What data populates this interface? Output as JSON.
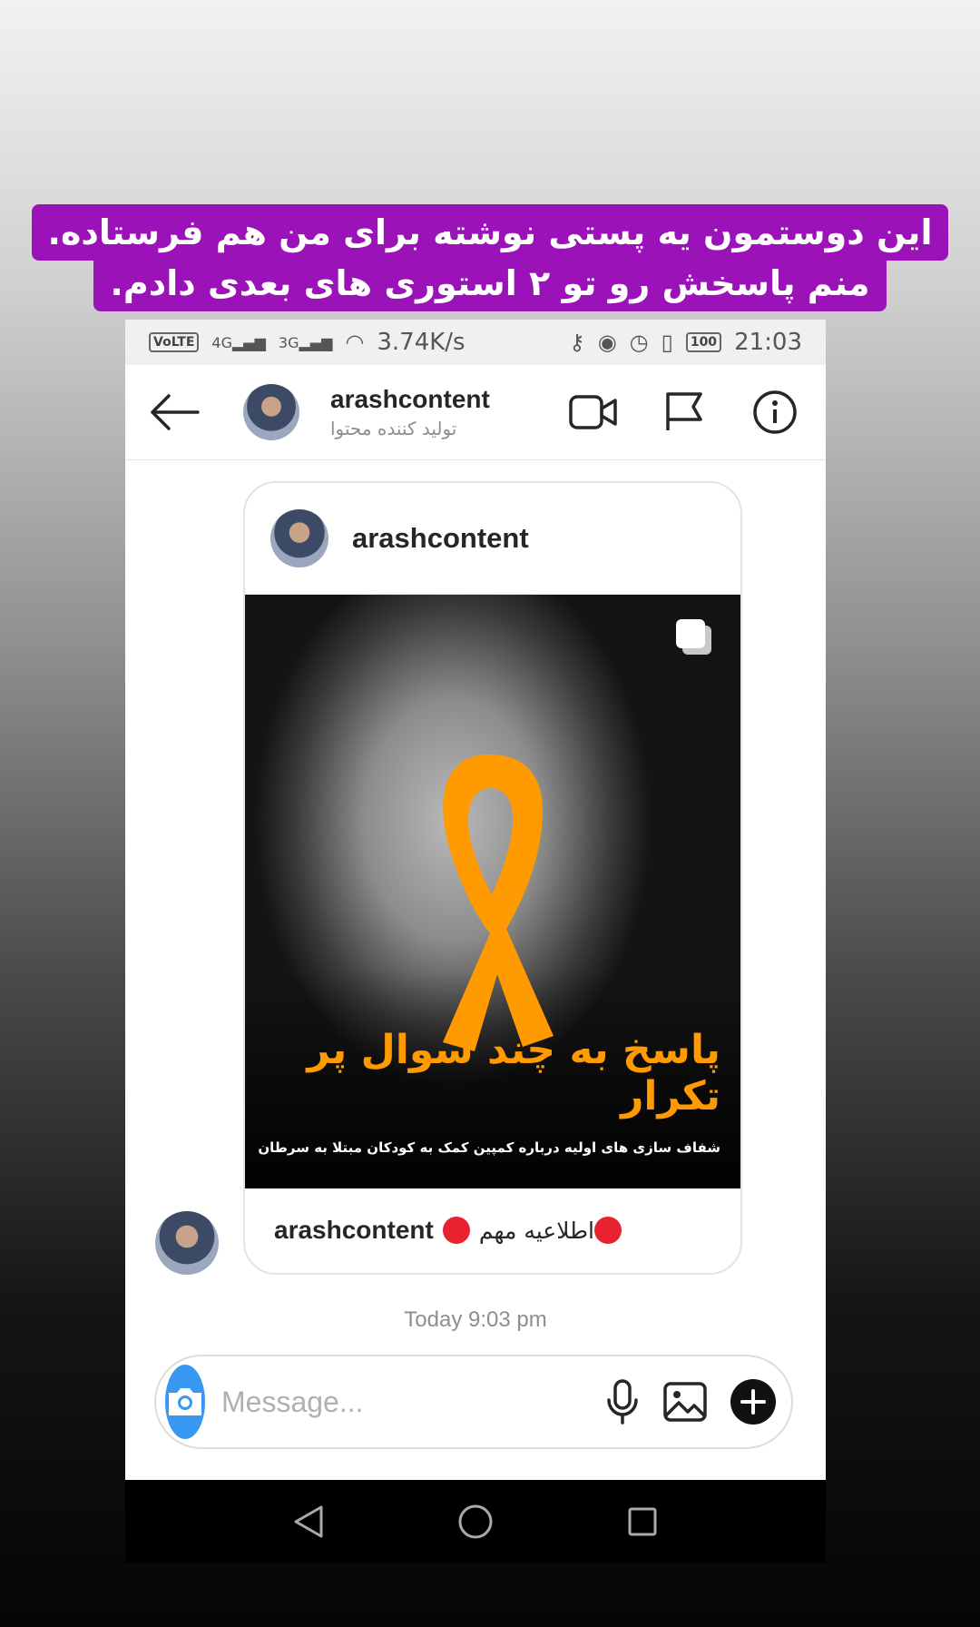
{
  "caption": {
    "line1": "این دوستمون یه پستی نوشته برای من هم فرستاده.",
    "line2": "منم پاسخش رو تو ۲ استوری های بعدی دادم."
  },
  "status_bar": {
    "volte": "VoLTE",
    "net1": "4G",
    "net2": "3G",
    "speed": "3.74K/s",
    "battery": "100",
    "time": "21:03"
  },
  "header": {
    "username": "arashcontent",
    "subtitle": "تولید کننده محتوا"
  },
  "post": {
    "username": "arashcontent",
    "image_title": "پاسخ به چند سوال پر تکرار",
    "image_subtitle": "شفاف سازی های اولیه درباره کمپین کمک به کودکان مبتلا به سرطان",
    "footer_author": "arashcontent",
    "footer_caption": "اطلاعیه مهم",
    "accent_color": "#ff9a00"
  },
  "timestamp": "Today 9:03 pm",
  "composer": {
    "placeholder": "Message..."
  },
  "icons": {
    "back": "arrow-left-icon",
    "video": "video-camera-icon",
    "flag": "flag-icon",
    "info": "info-icon",
    "camera": "camera-icon",
    "mic": "microphone-icon",
    "gallery": "image-icon",
    "plus": "plus-icon"
  }
}
